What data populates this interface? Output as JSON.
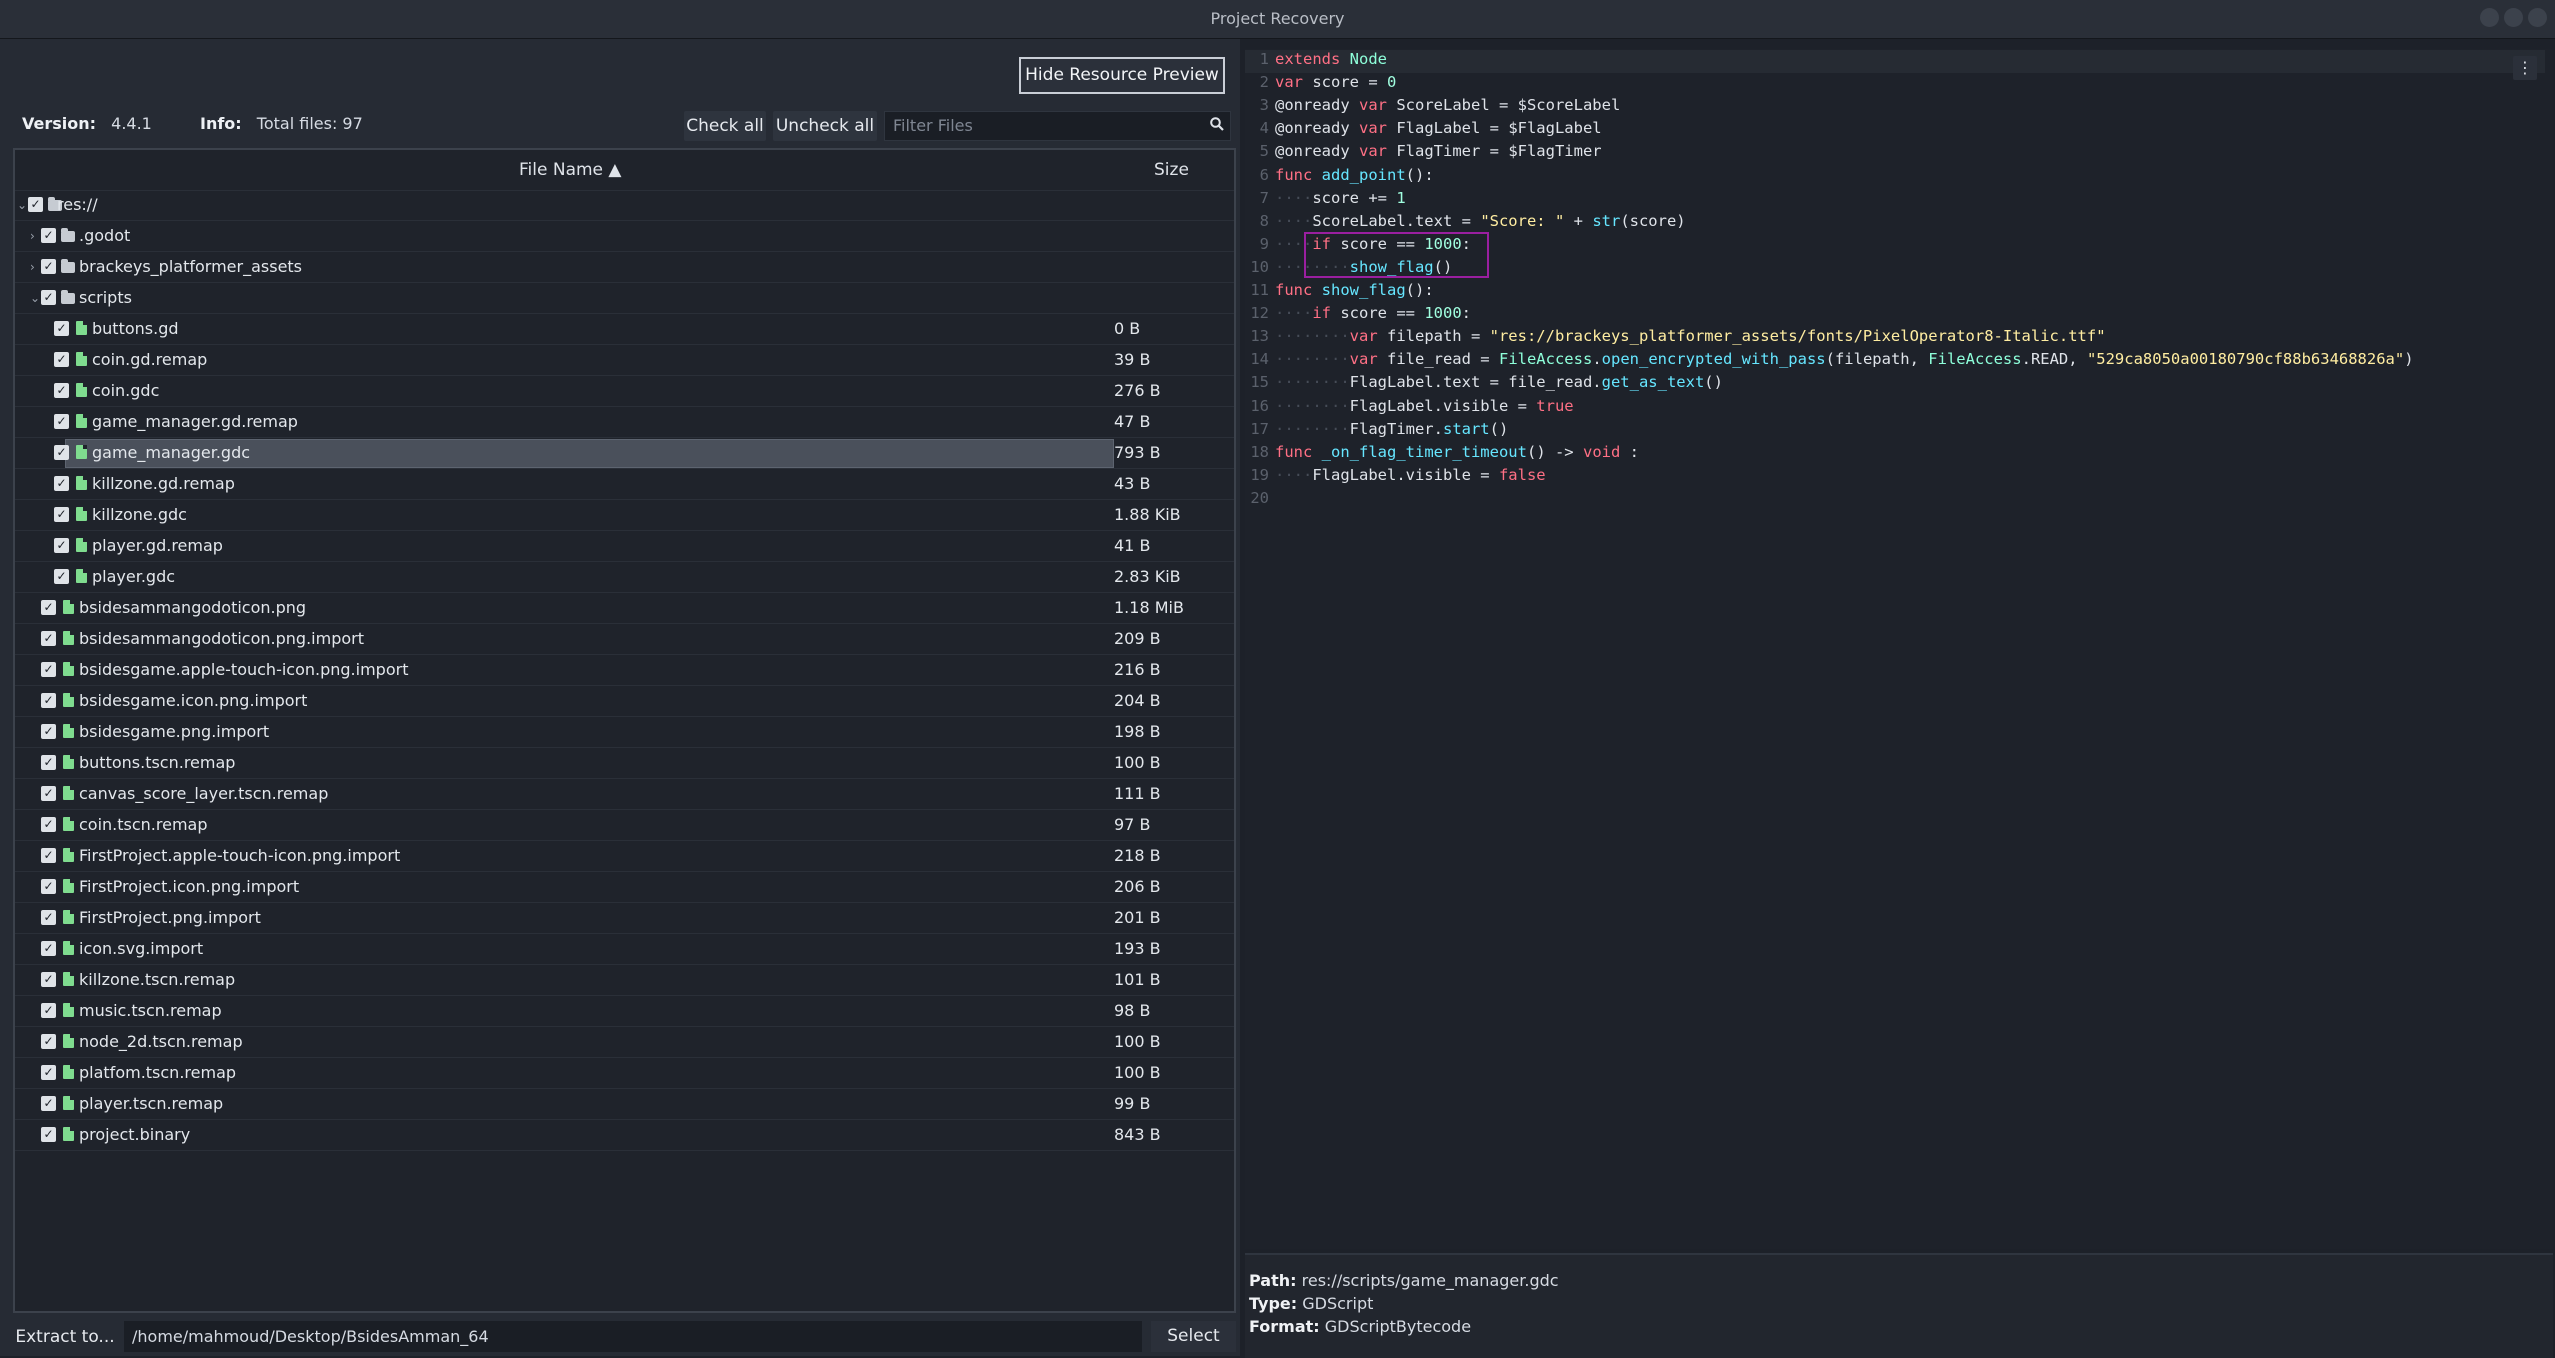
{
  "window": {
    "title": "Project Recovery"
  },
  "header": {
    "hide_preview_label": "Hide Resource Preview",
    "version_label": "Version:",
    "version_value": "4.4.1",
    "info_label": "Info:",
    "info_value": "Total files: 97",
    "check_all_label": "Check all",
    "uncheck_all_label": "Uncheck all",
    "filter_placeholder": "Filter Files"
  },
  "tree": {
    "col_name": "File Name ▲",
    "col_size": "Size",
    "rows": [
      {
        "name": "res://",
        "size": "",
        "depth": 0,
        "type": "folder",
        "expanded": true
      },
      {
        "name": ".godot",
        "size": "",
        "depth": 1,
        "type": "folder",
        "expanded": false
      },
      {
        "name": "brackeys_platformer_assets",
        "size": "",
        "depth": 1,
        "type": "folder",
        "expanded": false
      },
      {
        "name": "scripts",
        "size": "",
        "depth": 1,
        "type": "folder",
        "expanded": true
      },
      {
        "name": "buttons.gd",
        "size": "0 B",
        "depth": 2,
        "type": "file"
      },
      {
        "name": "coin.gd.remap",
        "size": "39 B",
        "depth": 2,
        "type": "file"
      },
      {
        "name": "coin.gdc",
        "size": "276 B",
        "depth": 2,
        "type": "file"
      },
      {
        "name": "game_manager.gd.remap",
        "size": "47 B",
        "depth": 2,
        "type": "file"
      },
      {
        "name": "game_manager.gdc",
        "size": "793 B",
        "depth": 2,
        "type": "file",
        "selected": true
      },
      {
        "name": "killzone.gd.remap",
        "size": "43 B",
        "depth": 2,
        "type": "file"
      },
      {
        "name": "killzone.gdc",
        "size": "1.88 KiB",
        "depth": 2,
        "type": "file"
      },
      {
        "name": "player.gd.remap",
        "size": "41 B",
        "depth": 2,
        "type": "file"
      },
      {
        "name": "player.gdc",
        "size": "2.83 KiB",
        "depth": 2,
        "type": "file"
      },
      {
        "name": "bsidesammangodoticon.png",
        "size": "1.18 MiB",
        "depth": 1,
        "type": "file"
      },
      {
        "name": "bsidesammangodoticon.png.import",
        "size": "209 B",
        "depth": 1,
        "type": "file"
      },
      {
        "name": "bsidesgame.apple-touch-icon.png.import",
        "size": "216 B",
        "depth": 1,
        "type": "file"
      },
      {
        "name": "bsidesgame.icon.png.import",
        "size": "204 B",
        "depth": 1,
        "type": "file"
      },
      {
        "name": "bsidesgame.png.import",
        "size": "198 B",
        "depth": 1,
        "type": "file"
      },
      {
        "name": "buttons.tscn.remap",
        "size": "100 B",
        "depth": 1,
        "type": "file"
      },
      {
        "name": "canvas_score_layer.tscn.remap",
        "size": "111 B",
        "depth": 1,
        "type": "file"
      },
      {
        "name": "coin.tscn.remap",
        "size": "97 B",
        "depth": 1,
        "type": "file"
      },
      {
        "name": "FirstProject.apple-touch-icon.png.import",
        "size": "218 B",
        "depth": 1,
        "type": "file"
      },
      {
        "name": "FirstProject.icon.png.import",
        "size": "206 B",
        "depth": 1,
        "type": "file"
      },
      {
        "name": "FirstProject.png.import",
        "size": "201 B",
        "depth": 1,
        "type": "file"
      },
      {
        "name": "icon.svg.import",
        "size": "193 B",
        "depth": 1,
        "type": "file"
      },
      {
        "name": "killzone.tscn.remap",
        "size": "101 B",
        "depth": 1,
        "type": "file"
      },
      {
        "name": "music.tscn.remap",
        "size": "98 B",
        "depth": 1,
        "type": "file"
      },
      {
        "name": "node_2d.tscn.remap",
        "size": "100 B",
        "depth": 1,
        "type": "file"
      },
      {
        "name": "platfom.tscn.remap",
        "size": "100 B",
        "depth": 1,
        "type": "file"
      },
      {
        "name": "player.tscn.remap",
        "size": "99 B",
        "depth": 1,
        "type": "file"
      },
      {
        "name": "project.binary",
        "size": "843 B",
        "depth": 1,
        "type": "file"
      }
    ]
  },
  "extract": {
    "button_label": "Extract to...",
    "path": "/home/mahmoud/Desktop/BsidesAmman_64",
    "select_label": "Select"
  },
  "code": {
    "menu_icon": "⋮",
    "lines": [
      [
        [
          "kw",
          "extends"
        ],
        [
          "ws",
          " "
        ],
        [
          "ty",
          "Node"
        ]
      ],
      [
        [
          "kw",
          "var"
        ],
        [
          "p",
          " score = "
        ],
        [
          "num",
          "0"
        ]
      ],
      [
        [
          "p",
          "@onready "
        ],
        [
          "kw",
          "var"
        ],
        [
          "p",
          " ScoreLabel = $ScoreLabel"
        ]
      ],
      [
        [
          "p",
          "@onready "
        ],
        [
          "kw",
          "var"
        ],
        [
          "p",
          " FlagLabel = $FlagLabel"
        ]
      ],
      [
        [
          "p",
          "@onready "
        ],
        [
          "kw",
          "var"
        ],
        [
          "p",
          " FlagTimer = $FlagTimer"
        ]
      ],
      [
        [
          "kw",
          "func"
        ],
        [
          "p",
          " "
        ],
        [
          "fn2",
          "add_point"
        ],
        [
          "p",
          "():"
        ]
      ],
      [
        [
          "ws",
          "····"
        ],
        [
          "p",
          "score += "
        ],
        [
          "num",
          "1"
        ]
      ],
      [
        [
          "ws",
          "····"
        ],
        [
          "p",
          "ScoreLabel.text = "
        ],
        [
          "str",
          "\"Score: \""
        ],
        [
          "p",
          " + "
        ],
        [
          "fn2",
          "str"
        ],
        [
          "p",
          "(score)"
        ]
      ],
      [
        [
          "ws",
          "····"
        ],
        [
          "kw",
          "if"
        ],
        [
          "p",
          " score == "
        ],
        [
          "num",
          "1000"
        ],
        [
          "p",
          ":"
        ]
      ],
      [
        [
          "ws",
          "········"
        ],
        [
          "fn2",
          "show_flag"
        ],
        [
          "p",
          "()"
        ]
      ],
      [
        [
          "kw",
          "func"
        ],
        [
          "p",
          " "
        ],
        [
          "fn2",
          "show_flag"
        ],
        [
          "p",
          "():"
        ]
      ],
      [
        [
          "ws",
          "····"
        ],
        [
          "kw",
          "if"
        ],
        [
          "p",
          " score == "
        ],
        [
          "num",
          "1000"
        ],
        [
          "p",
          ":"
        ]
      ],
      [
        [
          "ws",
          "········"
        ],
        [
          "kw",
          "var"
        ],
        [
          "p",
          " filepath = "
        ],
        [
          "str",
          "\"res://brackeys_platformer_assets/fonts/PixelOperator8-Italic.ttf\""
        ]
      ],
      [
        [
          "ws",
          "········"
        ],
        [
          "kw",
          "var"
        ],
        [
          "p",
          " file_read = "
        ],
        [
          "ty",
          "FileAccess"
        ],
        [
          "p",
          "."
        ],
        [
          "fn2",
          "open_encrypted_with_pass"
        ],
        [
          "p",
          "(filepath, "
        ],
        [
          "ty",
          "FileAccess"
        ],
        [
          "p",
          ".READ, "
        ],
        [
          "str",
          "\"529ca8050a00180790cf88b63468826a\""
        ],
        [
          "p",
          ")"
        ]
      ],
      [
        [
          "ws",
          "········"
        ],
        [
          "p",
          "FlagLabel.text = file_read."
        ],
        [
          "fn2",
          "get_as_text"
        ],
        [
          "p",
          "()"
        ]
      ],
      [
        [
          "ws",
          "········"
        ],
        [
          "p",
          "FlagLabel.visible = "
        ],
        [
          "kw",
          "true"
        ]
      ],
      [
        [
          "ws",
          "········"
        ],
        [
          "p",
          "FlagTimer."
        ],
        [
          "fn2",
          "start"
        ],
        [
          "p",
          "()"
        ]
      ],
      [
        [
          "kw",
          "func"
        ],
        [
          "p",
          " "
        ],
        [
          "fn2",
          "_on_flag_timer_timeout"
        ],
        [
          "p",
          "() -> "
        ],
        [
          "kw",
          "void"
        ],
        [
          "p",
          " :"
        ]
      ],
      [
        [
          "ws",
          "····"
        ],
        [
          "p",
          "FlagLabel.visible = "
        ],
        [
          "kw",
          "false"
        ]
      ],
      []
    ]
  },
  "info_panel": {
    "path_label": "Path:",
    "path_value": "res://scripts/game_manager.gdc",
    "type_label": "Type:",
    "type_value": "GDScript",
    "format_label": "Format:",
    "format_value": "GDScriptBytecode"
  }
}
